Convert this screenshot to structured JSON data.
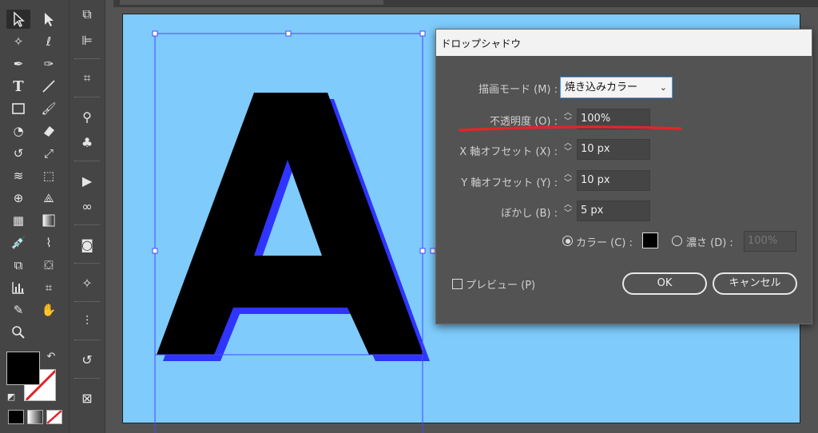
{
  "dialog": {
    "title": "ドロップシャドウ",
    "blend_mode": {
      "label": "描画モード (M) :",
      "value": "焼き込みカラー"
    },
    "opacity": {
      "label": "不透明度 (O) :",
      "value": "100%"
    },
    "x_offset": {
      "label": "X 軸オフセット (X) :",
      "value": "10 px"
    },
    "y_offset": {
      "label": "Y 軸オフセット (Y) :",
      "value": "10 px"
    },
    "blur": {
      "label": "ぼかし (B) :",
      "value": "5 px"
    },
    "color_option": {
      "label": "カラー (C) :",
      "swatch": "#000000",
      "selected": true
    },
    "darkness_option": {
      "label": "濃さ (D) :",
      "value": "100%",
      "selected": false
    },
    "preview": {
      "label": "プレビュー (P)",
      "checked": false
    },
    "ok_label": "OK",
    "cancel_label": "キャンセル",
    "highlight_color": "#e0262a"
  },
  "artwork": {
    "letter": "A",
    "letter_color": "#000000",
    "shadow_color": "#2b2bff",
    "artboard_color": "#7ecbfc"
  },
  "colors": {
    "accent": "#3ba0ff",
    "panel": "#454545"
  }
}
